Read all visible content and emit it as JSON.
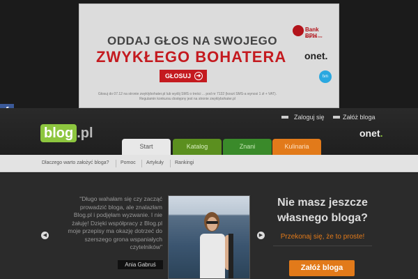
{
  "ad": {
    "line1": "ODDAJ GŁOS NA SWOJEGO",
    "line2": "ZWYKŁEGO BOHATERA",
    "button": "GŁOSUJ",
    "small_print": "Głosuj do 07.12 na stronie zwyklybohater.pl lub wyślij SMS o treści ... pod nr 7132 (koszt SMS-a wynosi 1 zł + VAT). Regulamin konkursu dostępny jest na stronie zwyklybohater.pl",
    "bank": "Bank BPH",
    "bank_sub": "Po prostu bez",
    "onet": "onet.",
    "tvn": "tvn"
  },
  "facebook_icon": "f",
  "header": {
    "logo_main": "blog",
    "logo_suffix": ".pl",
    "login": "Zaloguj się",
    "register": "Załóż bloga",
    "onet": "onet",
    "onet_dot": "."
  },
  "tabs": [
    {
      "label": "Start"
    },
    {
      "label": "Katalog"
    },
    {
      "label": "Znani"
    },
    {
      "label": "Kulinaria"
    }
  ],
  "subnav": [
    {
      "label": "Dlaczego warto założyć bloga?"
    },
    {
      "label": "Pomoc"
    },
    {
      "label": "Artykuły"
    },
    {
      "label": "Rankingi"
    }
  ],
  "testimonial": {
    "quote": "\"Długo wahałam się czy zacząć prowadzić bloga, ale znalazłam Blog.pl i podjęłam wyzwanie. I nie żałuję! Dzięki współpracy z Blog.pl moje przepisy ma okazję dotrzeć do szerszego grona wspaniałych czytelników\"",
    "author": "Ania Gabruś"
  },
  "promo": {
    "title": "Nie masz jeszcze własnego bloga?",
    "subtitle": "Przekonaj się, że to proste!",
    "cta": "Załóż bloga"
  },
  "colors": {
    "accent_green": "#8dc63f",
    "accent_orange": "#e27a1a",
    "ad_red": "#c41a1f"
  }
}
